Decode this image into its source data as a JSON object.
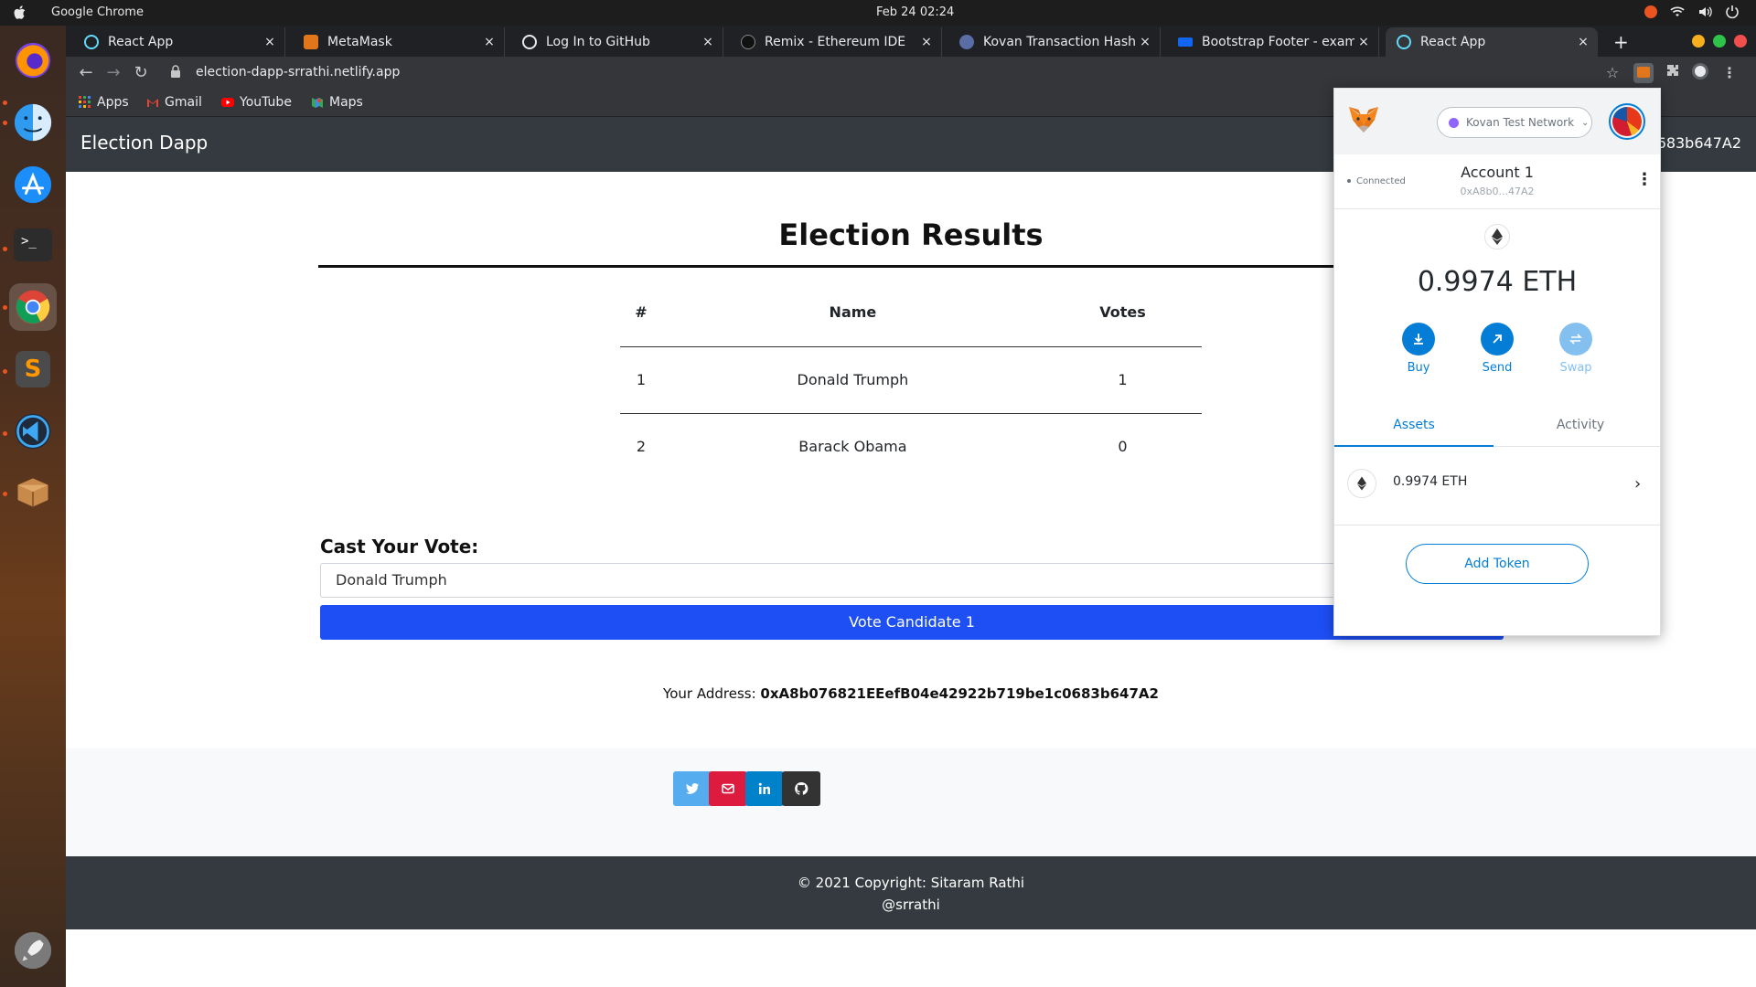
{
  "os": {
    "app_name": "Google Chrome",
    "clock": "Feb 24  02:24"
  },
  "tabs": [
    {
      "title": "React App",
      "favicon": "react-icon",
      "color": "#61dafb"
    },
    {
      "title": "MetaMask",
      "favicon": "metamask-fox-icon",
      "color": "#e2761b"
    },
    {
      "title": "Log In to GitHub",
      "favicon": "github-icon",
      "color": "#e8eaed"
    },
    {
      "title": "Remix - Ethereum IDE",
      "favicon": "remix-icon",
      "color": "#2a2a2a"
    },
    {
      "title": "Kovan Transaction Hash (",
      "favicon": "etherscan-icon",
      "color": "#5a6ea5"
    },
    {
      "title": "Bootstrap Footer - examp",
      "favicon": "mdb-icon",
      "color": "#1266f1"
    },
    {
      "title": "React App",
      "favicon": "react-icon",
      "color": "#61dafb",
      "active": true
    }
  ],
  "tab_close_glyph": "×",
  "toolbar": {
    "url": "election-dapp-srrathi.netlify.app"
  },
  "bookmarks": [
    {
      "label": "Apps",
      "icon": "apps-grid-icon"
    },
    {
      "label": "Gmail",
      "icon": "gmail-icon"
    },
    {
      "label": "YouTube",
      "icon": "youtube-icon"
    },
    {
      "label": "Maps",
      "icon": "maps-icon"
    }
  ],
  "dapp": {
    "brand": "Election Dapp",
    "nav_address_visible": "0683b647A2",
    "results_title": "Election Results",
    "table": {
      "headers": [
        "#",
        "Name",
        "Votes"
      ],
      "rows": [
        [
          "1",
          "Donald Trumph",
          "1"
        ],
        [
          "2",
          "Barack Obama",
          "0"
        ]
      ]
    },
    "cast_label": "Cast Your Vote:",
    "selected_candidate": "Donald Trumph",
    "vote_button": "Vote Candidate 1",
    "address_label": "Your Address:",
    "address_value": "0xA8b076821EEefB04e42922b719be1c0683b647A2",
    "social": [
      {
        "name": "twitter-icon",
        "color": "#55acee"
      },
      {
        "name": "email-icon",
        "color": "#dd1b3f"
      },
      {
        "name": "linkedin-icon",
        "color": "#0082ca"
      },
      {
        "name": "github-icon",
        "color": "#333333"
      }
    ],
    "footer_line1": "© 2021 Copyright: Sitaram Rathi",
    "footer_line2": "@srrathi"
  },
  "metamask": {
    "network": "Kovan Test Network",
    "connected": "Connected",
    "account_name": "Account 1",
    "account_short": "0xA8b0...47A2",
    "balance": "0.9974 ETH",
    "actions": [
      {
        "label": "Buy",
        "icon": "download-icon",
        "color": "#037dd6",
        "disabled": false
      },
      {
        "label": "Send",
        "icon": "send-arrow-icon",
        "color": "#037dd6",
        "disabled": false
      },
      {
        "label": "Swap",
        "icon": "swap-icon",
        "color": "#84c0ef",
        "disabled": true
      }
    ],
    "tab_assets": "Assets",
    "tab_activity": "Activity",
    "asset_label": "0.9974 ETH",
    "add_token": "Add Token"
  }
}
